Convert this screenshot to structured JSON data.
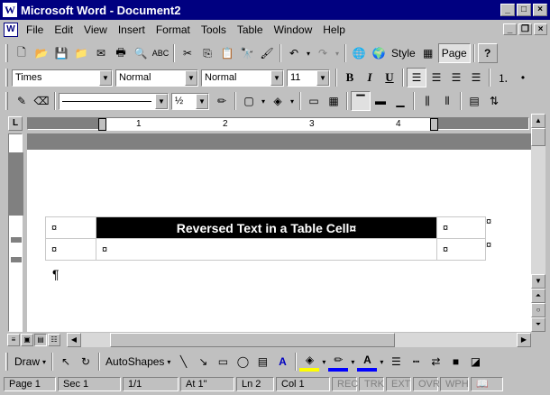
{
  "window": {
    "title": "Microsoft Word - Document2",
    "app_icon": "W"
  },
  "menu": {
    "items": [
      "File",
      "Edit",
      "View",
      "Insert",
      "Format",
      "Tools",
      "Table",
      "Window",
      "Help"
    ]
  },
  "standard_toolbar": {
    "style_label": "Style",
    "page_label": "Page",
    "help_label": "?"
  },
  "formatting_toolbar": {
    "style_combo": "Normal",
    "font_combo": "Times",
    "style_combo2": "Normal",
    "size_combo": "11",
    "bold": "B",
    "italic": "I",
    "underline": "U"
  },
  "tables_toolbar": {
    "line_weight": "½"
  },
  "ruler": {
    "numbers": [
      "1",
      "2",
      "3",
      "4"
    ]
  },
  "document": {
    "table": {
      "rows": [
        [
          "¤",
          "Reversed Text in a Table Cell¤",
          "¤"
        ],
        [
          "¤",
          "¤",
          "¤"
        ]
      ],
      "row_end_marks": [
        "¤",
        "¤"
      ]
    },
    "paragraph_mark": "¶"
  },
  "drawing_toolbar": {
    "draw_label": "Draw",
    "autoshapes_label": "AutoShapes"
  },
  "status_bar": {
    "page": "Page 1",
    "sec": "Sec 1",
    "pages": "1/1",
    "at": "At 1\"",
    "ln": "Ln 2",
    "col": "Col 1",
    "rec": "REC",
    "trk": "TRK",
    "ext": "EXT",
    "ovr": "OVR",
    "wph": "WPH"
  },
  "colors": {
    "titlebar": "#000080",
    "chrome": "#c0c0c0",
    "reversed_cell": "#000000",
    "fill_highlight": "#ffff00",
    "font_color": "#0000ff"
  }
}
